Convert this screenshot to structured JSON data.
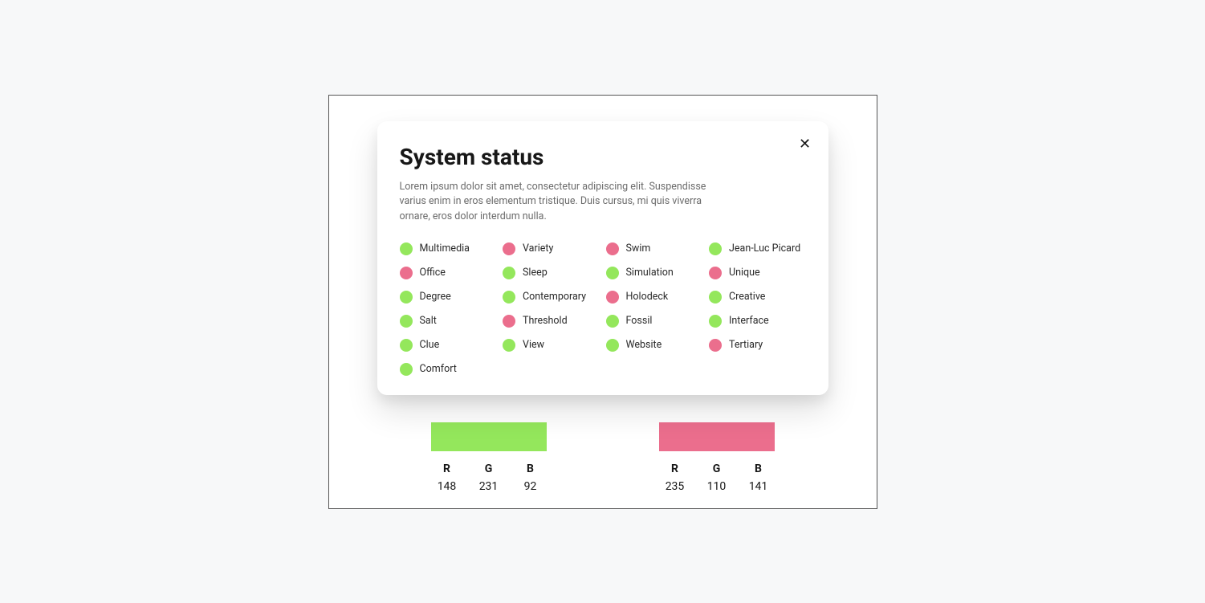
{
  "dialog": {
    "title": "System status",
    "description": "Lorem ipsum dolor sit amet, consectetur adipiscing elit. Suspendisse varius enim in eros elementum tristique. Duis cursus, mi quis viverra ornare, eros dolor interdum nulla.",
    "close_label": "✕"
  },
  "status_items": [
    {
      "label": "Multimedia",
      "state": "green"
    },
    {
      "label": "Variety",
      "state": "pink"
    },
    {
      "label": "Swim",
      "state": "pink"
    },
    {
      "label": "Jean-Luc Picard",
      "state": "green"
    },
    {
      "label": "Office",
      "state": "pink"
    },
    {
      "label": "Sleep",
      "state": "green"
    },
    {
      "label": "Simulation",
      "state": "green"
    },
    {
      "label": "Unique",
      "state": "pink"
    },
    {
      "label": "Degree",
      "state": "green"
    },
    {
      "label": "Contemporary",
      "state": "green"
    },
    {
      "label": "Holodeck",
      "state": "pink"
    },
    {
      "label": "Creative",
      "state": "green"
    },
    {
      "label": "Salt",
      "state": "green"
    },
    {
      "label": "Threshold",
      "state": "pink"
    },
    {
      "label": "Fossil",
      "state": "green"
    },
    {
      "label": "Interface",
      "state": "green"
    },
    {
      "label": "Clue",
      "state": "green"
    },
    {
      "label": "View",
      "state": "green"
    },
    {
      "label": "Website",
      "state": "green"
    },
    {
      "label": "Tertiary",
      "state": "pink"
    },
    {
      "label": "Comfort",
      "state": "green"
    }
  ],
  "colors": {
    "green": "#94e75c",
    "pink": "#eb6e8d"
  },
  "swatches": [
    {
      "color_key": "green",
      "rgb": {
        "R": "148",
        "G": "231",
        "B": "92"
      }
    },
    {
      "color_key": "pink",
      "rgb": {
        "R": "235",
        "G": "110",
        "B": "141"
      }
    }
  ],
  "rgb_labels": {
    "r": "R",
    "g": "G",
    "b": "B"
  }
}
